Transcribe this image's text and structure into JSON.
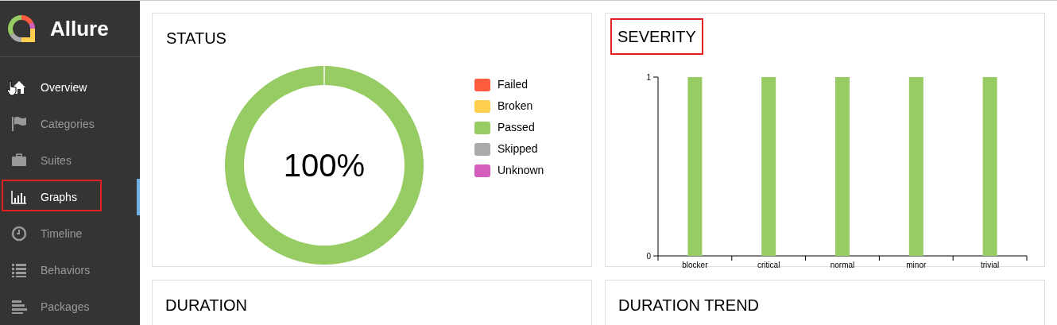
{
  "sidebar": {
    "brand": "Allure",
    "items": [
      {
        "label": "Overview",
        "selected": false,
        "hovered": true,
        "highlighted": false
      },
      {
        "label": "Categories",
        "selected": false,
        "hovered": false,
        "highlighted": false
      },
      {
        "label": "Suites",
        "selected": false,
        "hovered": false,
        "highlighted": false
      },
      {
        "label": "Graphs",
        "selected": true,
        "hovered": false,
        "highlighted": true
      },
      {
        "label": "Timeline",
        "selected": false,
        "hovered": false,
        "highlighted": false
      },
      {
        "label": "Behaviors",
        "selected": false,
        "hovered": false,
        "highlighted": false
      },
      {
        "label": "Packages",
        "selected": false,
        "hovered": false,
        "highlighted": false
      }
    ]
  },
  "status": {
    "title": "STATUS",
    "highlighted": false,
    "center_label": "100%",
    "legend": [
      {
        "color": "#fd5a3e"
      },
      {
        "color": "#ffd050"
      },
      {
        "color": "#97cc64"
      },
      {
        "color": "#aaaaaa"
      },
      {
        "color": "#d35ebe"
      }
    ],
    "chart_data": {
      "type": "pie",
      "categories": [
        "Failed",
        "Broken",
        "Passed",
        "Skipped",
        "Unknown"
      ],
      "values": [
        0,
        0,
        1,
        0,
        0
      ]
    }
  },
  "severity": {
    "title": "SEVERITY",
    "highlighted": true,
    "chart_data": {
      "type": "bar",
      "categories": [
        "blocker",
        "critical",
        "normal",
        "minor",
        "trivial"
      ],
      "series": [
        {
          "color": "#97cc64",
          "values": [
            1,
            1,
            1,
            1,
            1
          ]
        }
      ],
      "ylim": [
        0,
        1
      ],
      "yticks": [
        0,
        1
      ]
    }
  },
  "bottom_cards": [
    {
      "title": "DURATION"
    },
    {
      "title": "DURATION TREND"
    }
  ]
}
